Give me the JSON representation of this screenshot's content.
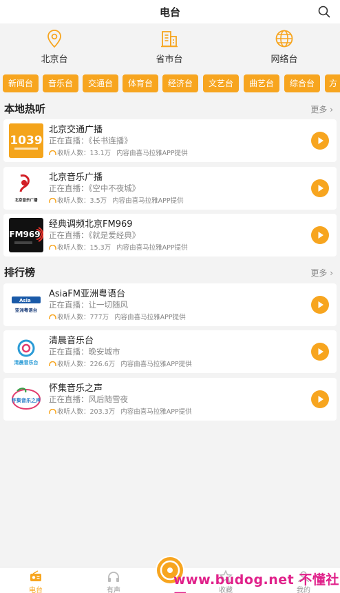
{
  "header": {
    "title": "电台"
  },
  "categories": [
    {
      "label": "北京台",
      "icon": "location-pin-icon"
    },
    {
      "label": "省市台",
      "icon": "building-icon"
    },
    {
      "label": "网络台",
      "icon": "globe-icon"
    }
  ],
  "chips": [
    "新闻台",
    "音乐台",
    "交通台",
    "体育台",
    "经济台",
    "文艺台",
    "曲艺台",
    "综合台",
    "方"
  ],
  "local": {
    "title": "本地热听",
    "more": "更多",
    "items": [
      {
        "name": "北京交通广播",
        "live": "正在直播：《长书连播》",
        "listeners": "收听人数：13.1万",
        "source": "内容由喜马拉雅APP提供",
        "logo_text": "1039"
      },
      {
        "name": "北京音乐广播",
        "live": "正在直播：《空中不夜城》",
        "listeners": "收听人数：3.5万",
        "source": "内容由喜马拉雅APP提供",
        "logo_text": "北京音乐广播"
      },
      {
        "name": "经典调频北京FM969",
        "live": "正在直播：《就是爱经典》",
        "listeners": "收听人数：15.3万",
        "source": "内容由喜马拉雅APP提供",
        "logo_text": "FM969"
      }
    ]
  },
  "ranking": {
    "title": "排行榜",
    "more": "更多",
    "items": [
      {
        "name": "AsiaFM亚洲粤语台",
        "live": "正在直播：让一切随风",
        "listeners": "收听人数：777万",
        "source": "内容由喜马拉雅APP提供",
        "logo_text": "亚洲粤语台"
      },
      {
        "name": "清晨音乐台",
        "live": "正在直播：晚安城市",
        "listeners": "收听人数：226.6万",
        "source": "内容由喜马拉雅APP提供",
        "logo_text": "清晨音乐台"
      },
      {
        "name": "怀集音乐之声",
        "live": "正在直播：风后随雪夜",
        "listeners": "收听人数：203.3万",
        "source": "内容由喜马拉雅APP提供",
        "logo_text": "怀集音乐之声"
      }
    ]
  },
  "tabs": [
    {
      "label": "电台",
      "icon": "radio-icon",
      "active": true
    },
    {
      "label": "有声",
      "icon": "headphones-icon",
      "active": false
    },
    {
      "label": "收藏",
      "icon": "star-icon",
      "active": false
    },
    {
      "label": "我的",
      "icon": "person-icon",
      "active": false
    }
  ],
  "watermark": {
    "text1": "www.budog.net",
    "text2": "不懂社区"
  },
  "colors": {
    "accent": "#f7a51f",
    "background": "#f3f3f3"
  }
}
